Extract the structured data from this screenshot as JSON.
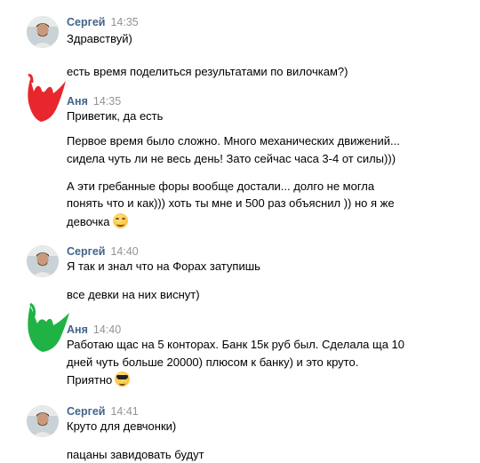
{
  "messages": [
    {
      "author": "Сергей",
      "time": "14:35",
      "lines": [
        "Здравствуй)",
        "есть время поделиться результатами по вилочкам?)"
      ]
    },
    {
      "author": "Аня",
      "time": "14:35",
      "lines": [
        "Приветик, да есть",
        "Первое время было сложно. Много механических движений...",
        "сидела чуть ли не весь день! Зато сейчас часа 3-4 от силы)))",
        "А эти гребанные форы вообще достали... долго не могла",
        "понять что и как))) хоть ты мне и 500 раз объяснил )) но я же",
        "девочка"
      ],
      "emoji": "smiling-face-icon"
    },
    {
      "author": "Сергей",
      "time": "14:40",
      "lines": [
        "Я так и знал что на Форах затупишь",
        "все девки на них виснут)"
      ]
    },
    {
      "author": "Аня",
      "time": "14:40",
      "lines": [
        "Работаю щас на 5 конторах. Банк 15к руб был. Сделала ща 10",
        "дней чуть больше 20000) плюсом к банку) и это круто.",
        "Приятно"
      ],
      "emoji": "sunglasses-face-icon"
    },
    {
      "author": "Сергей",
      "time": "14:41",
      "lines": [
        "Круто для девчонки)",
        "пацаны завидовать будут"
      ]
    }
  ],
  "colors": {
    "author_name": "#42648b",
    "timestamp": "#939393",
    "text": "#000000",
    "redaction_red": "#e8262d",
    "redaction_green": "#1fb345"
  }
}
